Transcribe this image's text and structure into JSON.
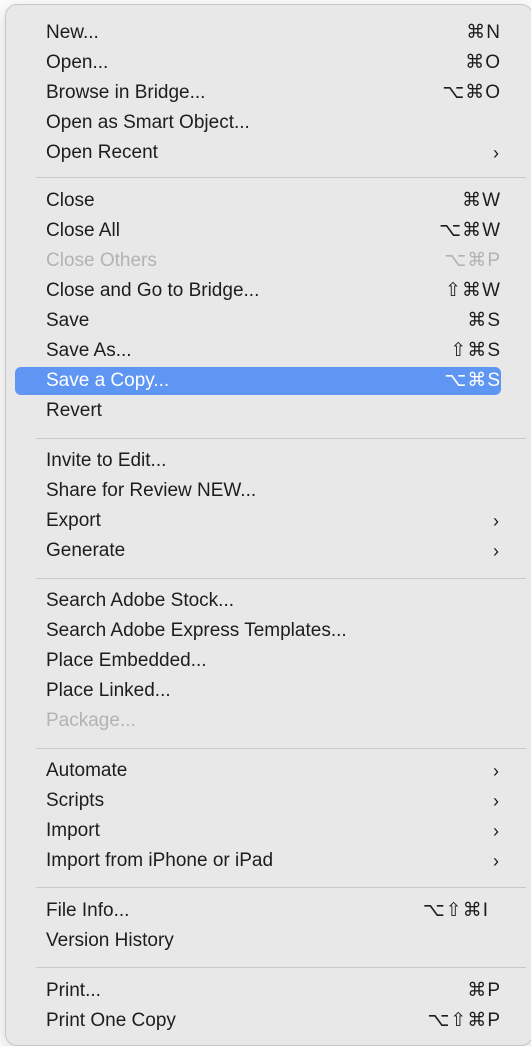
{
  "menu": {
    "items": [
      {
        "label": "New...",
        "shortcut": "⌘N"
      },
      {
        "label": "Open...",
        "shortcut": "⌘O"
      },
      {
        "label": "Browse in Bridge...",
        "shortcut": "⌥⌘O"
      },
      {
        "label": "Open as Smart Object..."
      },
      {
        "label": "Open Recent",
        "submenu": "›"
      },
      {
        "label": "Close",
        "shortcut": "⌘W"
      },
      {
        "label": "Close All",
        "shortcut": "⌥⌘W"
      },
      {
        "label": "Close Others",
        "shortcut": "⌥⌘P",
        "disabled": true
      },
      {
        "label": "Close and Go to Bridge...",
        "shortcut": "⇧⌘W"
      },
      {
        "label": "Save",
        "shortcut": "⌘S"
      },
      {
        "label": "Save As...",
        "shortcut": "⇧⌘S"
      },
      {
        "label": "Save a Copy...",
        "shortcut": "⌥⌘S",
        "highlighted": true
      },
      {
        "label": "Revert"
      },
      {
        "label": "Invite to Edit..."
      },
      {
        "label": "Share for Review NEW..."
      },
      {
        "label": "Export",
        "submenu": "›"
      },
      {
        "label": "Generate",
        "submenu": "›"
      },
      {
        "label": "Search Adobe Stock..."
      },
      {
        "label": "Search Adobe Express Templates..."
      },
      {
        "label": "Place Embedded..."
      },
      {
        "label": "Place Linked..."
      },
      {
        "label": "Package...",
        "disabled": true
      },
      {
        "label": "Automate",
        "submenu": "›"
      },
      {
        "label": "Scripts",
        "submenu": "›"
      },
      {
        "label": "Import",
        "submenu": "›"
      },
      {
        "label": "Import from iPhone or iPad",
        "submenu": "›"
      },
      {
        "label": "File Info...",
        "shortcut": "⌥⇧⌘I"
      },
      {
        "label": "Version History"
      },
      {
        "label": "Print...",
        "shortcut": "⌘P"
      },
      {
        "label": "Print One Copy",
        "shortcut": "⌥⇧⌘P"
      }
    ]
  },
  "colors": {
    "menu_background": "#e8e8e8",
    "highlight": "#5f96f3",
    "disabled_text": "#b3b3b3"
  }
}
